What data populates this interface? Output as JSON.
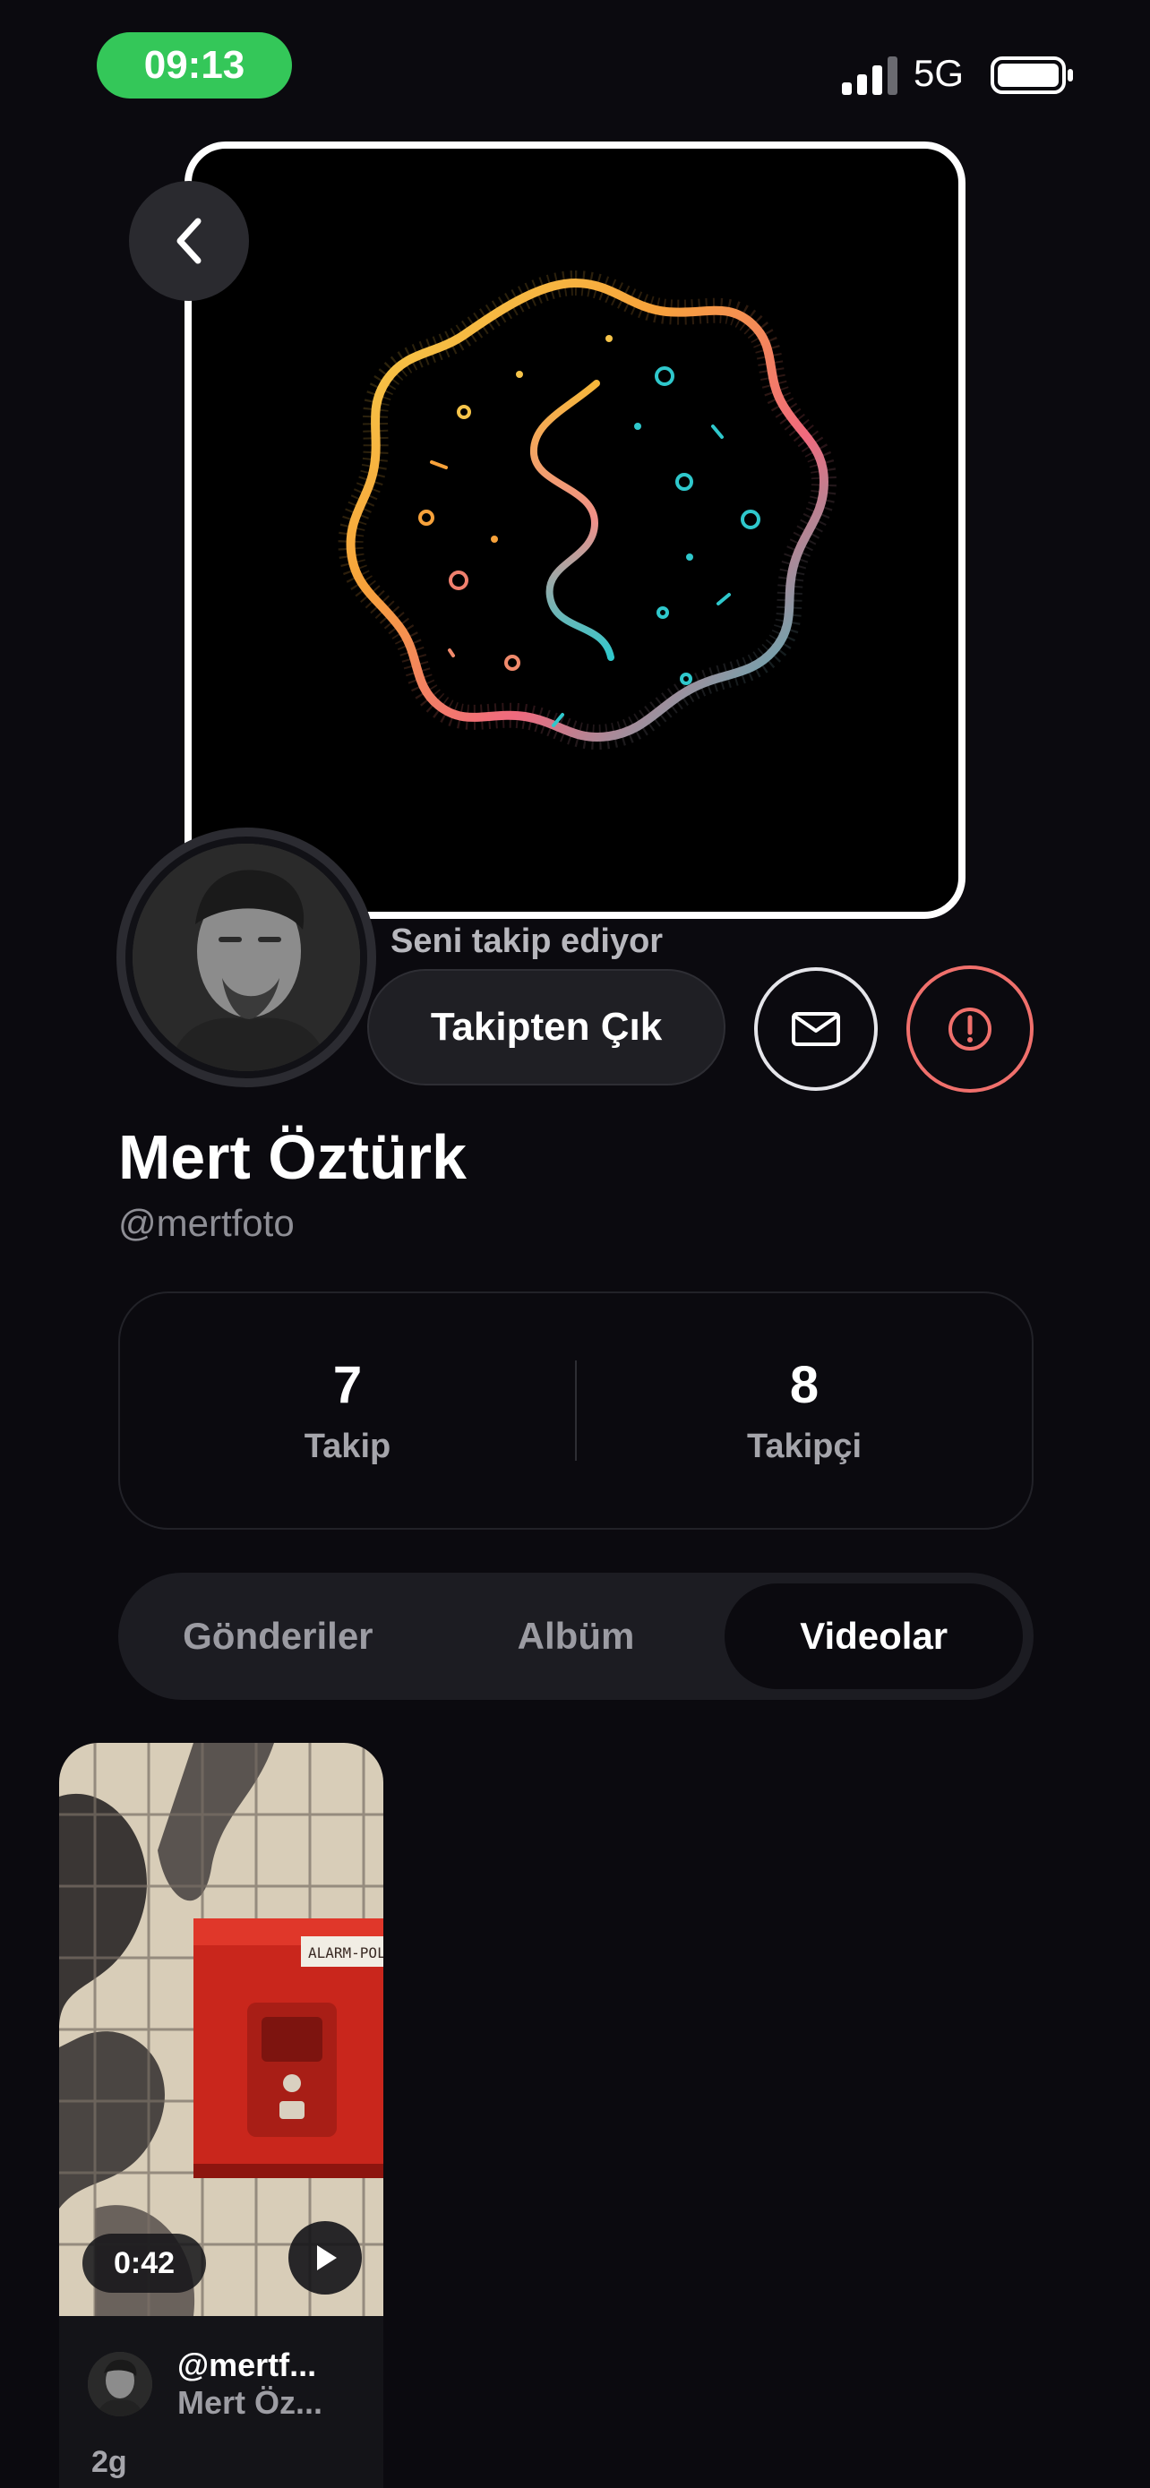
{
  "status_bar": {
    "time": "09:13",
    "network": "5G",
    "signal_bars_active": 3,
    "battery_level": 1.0
  },
  "profile": {
    "follow_status": "Seni takip ediyor",
    "unfollow_label": "Takipten Çık",
    "name": "Mert Öztürk",
    "handle": "@mertfoto",
    "icons": {
      "back": "chevron-left-icon",
      "message": "envelope-icon",
      "report": "exclamation-circle-icon"
    }
  },
  "stats": {
    "following_count": "7",
    "following_label": "Takip",
    "followers_count": "8",
    "followers_label": "Takipçi"
  },
  "tabs": [
    {
      "label": "Gönderiler",
      "active": false
    },
    {
      "label": "Albüm",
      "active": false
    },
    {
      "label": "Videolar",
      "active": true
    }
  ],
  "videos": [
    {
      "duration": "0:42",
      "thumb_sign_text": "ALARM-POLIS",
      "author_handle": "@mertf...",
      "author_name": "Mert Öz...",
      "age": "2g"
    }
  ],
  "colors": {
    "background": "#0b0a0f",
    "time_pill": "#34c759",
    "report": "#f0706c",
    "surface": "#1c1c22"
  }
}
